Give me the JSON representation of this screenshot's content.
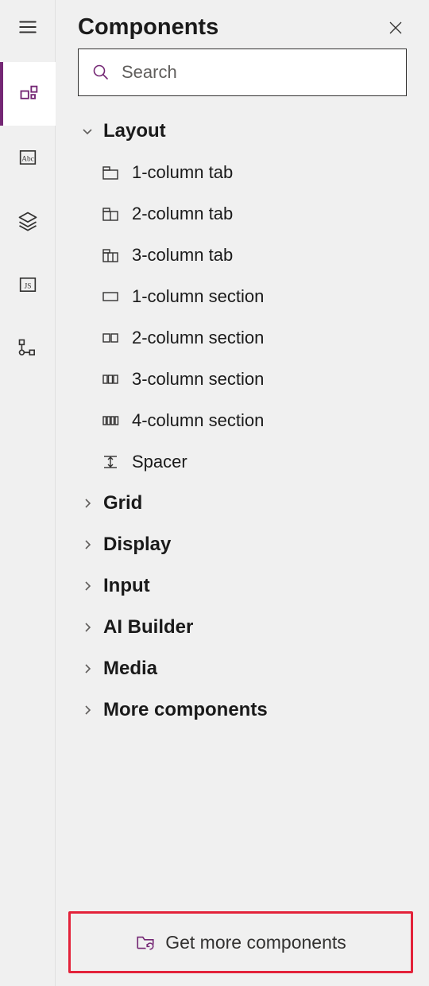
{
  "panel": {
    "title": "Components",
    "search_placeholder": "Search"
  },
  "groups": [
    {
      "label": "Layout",
      "expanded": true,
      "items": [
        {
          "label": "1-column tab",
          "icon": "1col-tab"
        },
        {
          "label": "2-column tab",
          "icon": "2col-tab"
        },
        {
          "label": "3-column tab",
          "icon": "3col-tab"
        },
        {
          "label": "1-column section",
          "icon": "1col-section"
        },
        {
          "label": "2-column section",
          "icon": "2col-section"
        },
        {
          "label": "3-column section",
          "icon": "3col-section"
        },
        {
          "label": "4-column section",
          "icon": "4col-section"
        },
        {
          "label": "Spacer",
          "icon": "spacer"
        }
      ]
    },
    {
      "label": "Grid",
      "expanded": false,
      "items": []
    },
    {
      "label": "Display",
      "expanded": false,
      "items": []
    },
    {
      "label": "Input",
      "expanded": false,
      "items": []
    },
    {
      "label": "AI Builder",
      "expanded": false,
      "items": []
    },
    {
      "label": "Media",
      "expanded": false,
      "items": []
    },
    {
      "label": "More components",
      "expanded": false,
      "items": []
    }
  ],
  "footer": {
    "label": "Get more components"
  }
}
